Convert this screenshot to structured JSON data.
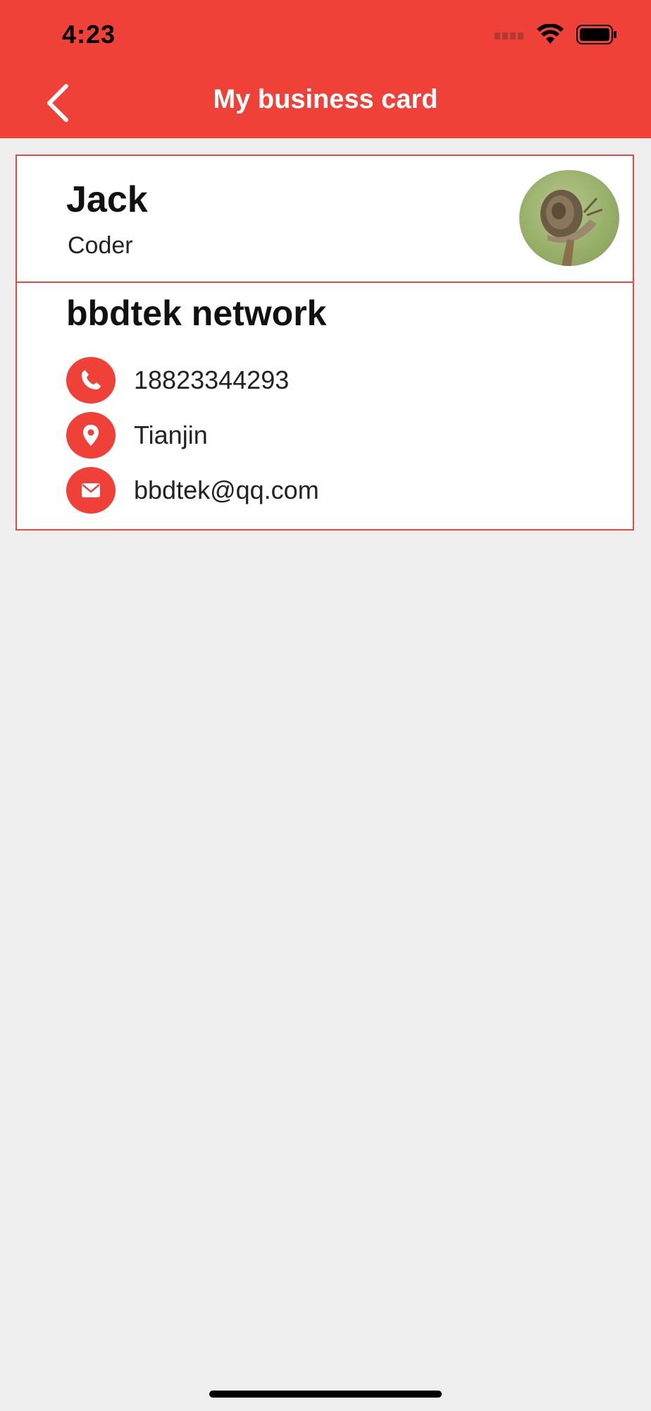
{
  "status_bar": {
    "time": "4:23",
    "signal_icon": "cellular-signal-icon",
    "wifi_icon": "wifi-icon",
    "battery_icon": "battery-icon"
  },
  "nav": {
    "title": "My business card",
    "back_icon": "chevron-left-icon"
  },
  "card": {
    "name": "Jack",
    "role": "Coder",
    "avatar_icon": "snail-photo-avatar",
    "company": "bbdtek network",
    "contacts": [
      {
        "icon": "phone-icon",
        "text": "18823344293"
      },
      {
        "icon": "location-pin-icon",
        "text": "Tianjin"
      },
      {
        "icon": "email-icon",
        "text": "bbdtek@qq.com"
      }
    ]
  },
  "colors": {
    "accent": "#ef4138",
    "card_border": "#e94b43",
    "background": "#efefef"
  }
}
